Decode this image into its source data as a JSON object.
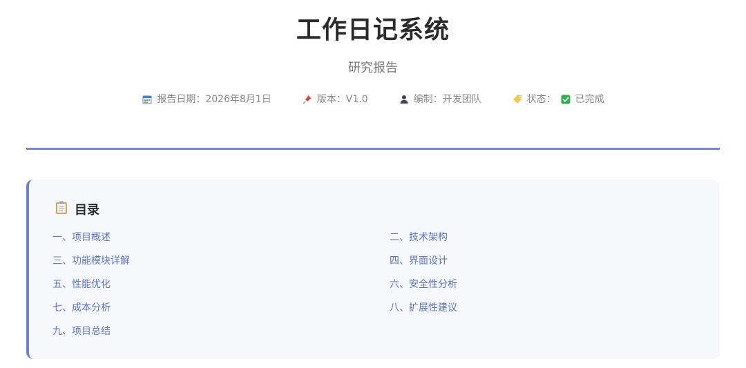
{
  "header": {
    "title": "工作日记系统",
    "subtitle": "研究报告"
  },
  "meta": [
    {
      "icon": "calendar-icon",
      "text": "报告日期：2026年8月1日"
    },
    {
      "icon": "pushpin-icon",
      "text": "版本：V1.0"
    },
    {
      "icon": "person-icon",
      "text": "编制：开发团队"
    },
    {
      "icon": "tag-icon",
      "label": "状态：",
      "check": "check-icon",
      "text": "已完成"
    }
  ],
  "toc": {
    "icon": "clipboard-icon",
    "title": "目录",
    "items": [
      "一、项目概述",
      "二、技术架构",
      "三、功能模块详解",
      "四、界面设计",
      "五、性能优化",
      "六、安全性分析",
      "七、成本分析",
      "八、扩展性建议",
      "九、项目总结"
    ]
  },
  "colors": {
    "accent": "#6c80d8",
    "link": "#5b74c9",
    "check_green": "#2bb24c"
  }
}
